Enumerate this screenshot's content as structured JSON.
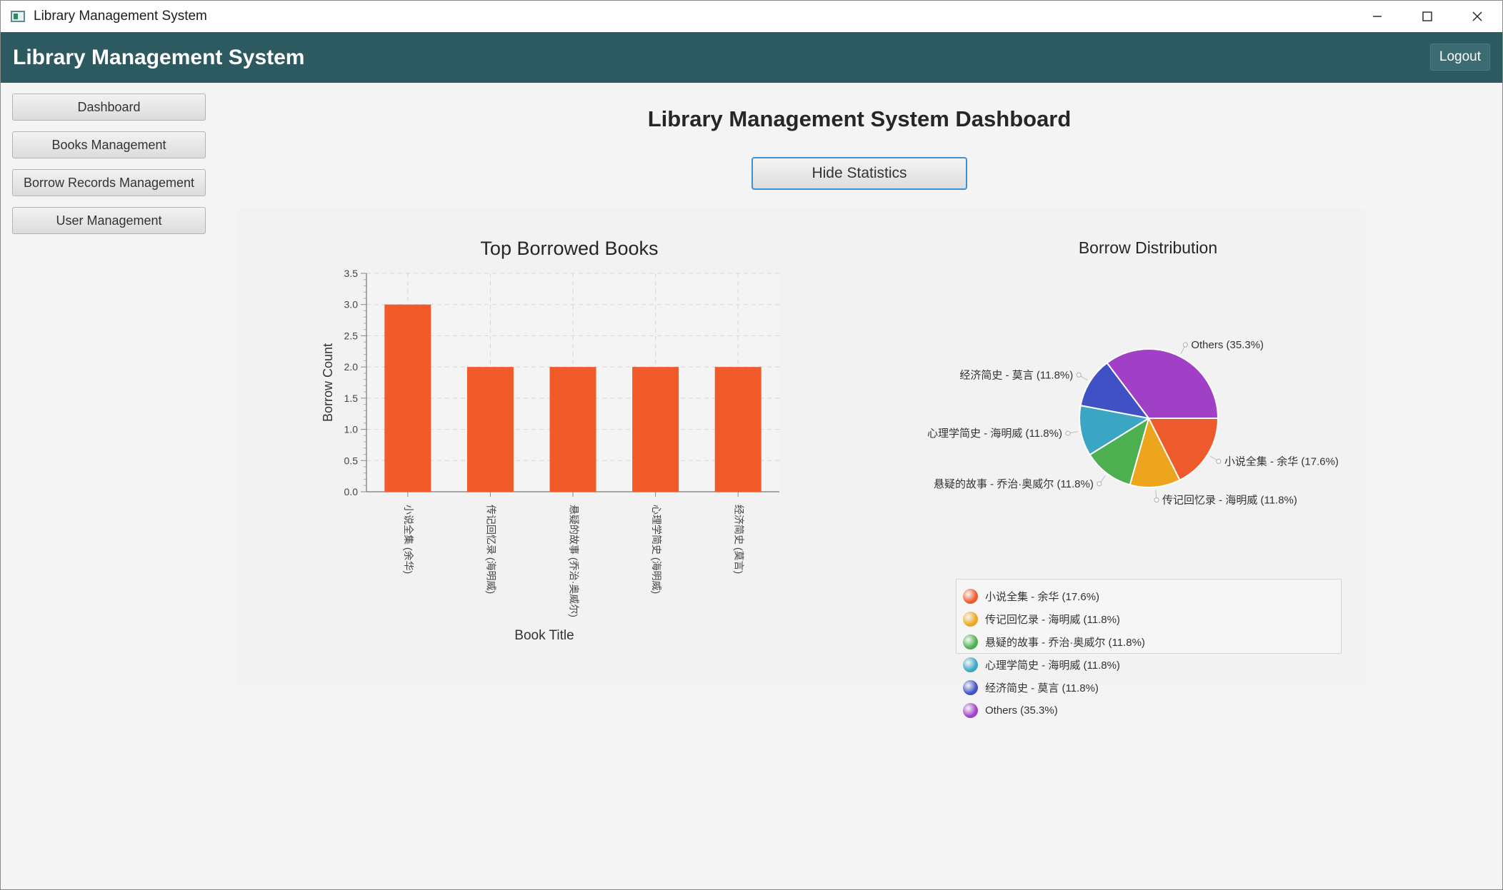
{
  "window": {
    "title": "Library Management System",
    "controls": [
      "minimize-icon",
      "maximize-icon",
      "close-icon"
    ]
  },
  "header": {
    "title": "Library Management System",
    "logout_label": "Logout"
  },
  "sidebar": {
    "items": [
      {
        "label": "Dashboard"
      },
      {
        "label": "Books Management"
      },
      {
        "label": "Borrow Records Management"
      },
      {
        "label": "User Management"
      }
    ]
  },
  "main": {
    "title": "Library Management System Dashboard",
    "toggle_label": "Hide Statistics"
  },
  "colors": {
    "header_bg": "#2d5960",
    "bar": "#f15a29",
    "focus_border": "#3d8fd6"
  },
  "chart_data": [
    {
      "type": "bar",
      "title": "Top Borrowed Books",
      "xlabel": "Book Title",
      "ylabel": "Borrow Count",
      "categories": [
        "小说全集 (余华)",
        "传记回忆录 (海明威)",
        "悬疑的故事 (乔治·奥威尔)",
        "心理学简史 (海明威)",
        "经济简史 (莫言)"
      ],
      "values": [
        3,
        2,
        2,
        2,
        2
      ],
      "ylim": [
        0,
        3.5
      ],
      "yticks": [
        "0.0",
        "0.5",
        "1.0",
        "1.5",
        "2.0",
        "2.5",
        "3.0",
        "3.5"
      ],
      "grid": true,
      "color": "#f15a29"
    },
    {
      "type": "pie",
      "title": "Borrow Distribution",
      "slices": [
        {
          "label": "小说全集 - 余华 (17.6%)",
          "value": 17.6,
          "color": "#ee5a2b"
        },
        {
          "label": "传记回忆录 - 海明威 (11.8%)",
          "value": 11.8,
          "color": "#eca51d"
        },
        {
          "label": "悬疑的故事 - 乔治·奥威尔 (11.8%)",
          "value": 11.8,
          "color": "#4caf50"
        },
        {
          "label": "心理学简史 - 海明威 (11.8%)",
          "value": 11.8,
          "color": "#3aa6c4"
        },
        {
          "label": "经济简史 - 莫言 (11.8%)",
          "value": 11.8,
          "color": "#3f51c4"
        },
        {
          "label": "Others (35.3%)",
          "value": 35.3,
          "color": "#a040c6"
        }
      ],
      "legend": "bottom"
    }
  ]
}
